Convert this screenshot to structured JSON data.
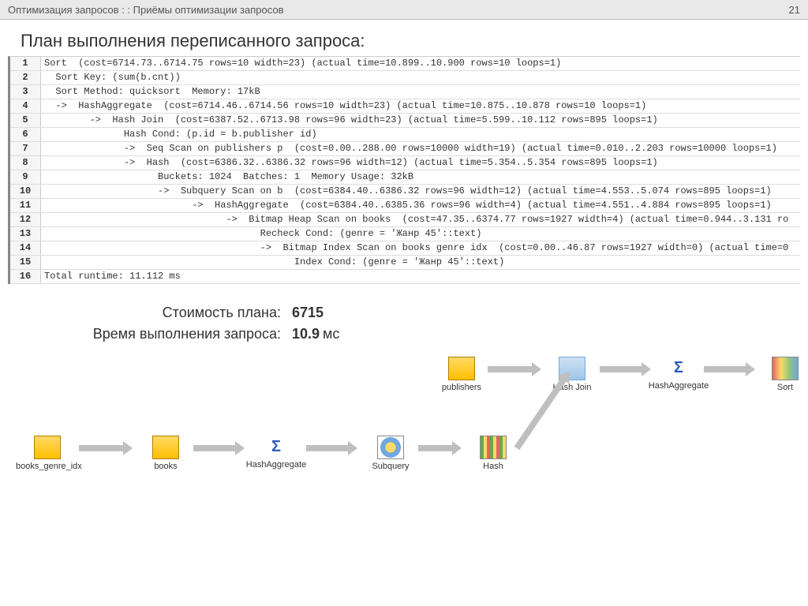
{
  "header": {
    "breadcrumb": "Оптимизация запросов  : :  Приёмы оптимизации запросов",
    "page": "21"
  },
  "title": "План выполнения переписанного запроса:",
  "plan_rows": [
    {
      "n": "1",
      "t": "Sort  (cost=6714.73..6714.75 rows=10 width=23) (actual time=10.899..10.900 rows=10 loops=1)"
    },
    {
      "n": "2",
      "t": "  Sort Key: (sum(b.cnt))"
    },
    {
      "n": "3",
      "t": "  Sort Method: quicksort  Memory: 17kB"
    },
    {
      "n": "4",
      "t": "  ->  HashAggregate  (cost=6714.46..6714.56 rows=10 width=23) (actual time=10.875..10.878 rows=10 loops=1)"
    },
    {
      "n": "5",
      "t": "        ->  Hash Join  (cost=6387.52..6713.98 rows=96 width=23) (actual time=5.599..10.112 rows=895 loops=1)"
    },
    {
      "n": "6",
      "t": "              Hash Cond: (p.id = b.publisher id)"
    },
    {
      "n": "7",
      "t": "              ->  Seq Scan on publishers p  (cost=0.00..288.00 rows=10000 width=19) (actual time=0.010..2.203 rows=10000 loops=1)"
    },
    {
      "n": "8",
      "t": "              ->  Hash  (cost=6386.32..6386.32 rows=96 width=12) (actual time=5.354..5.354 rows=895 loops=1)"
    },
    {
      "n": "9",
      "t": "                    Buckets: 1024  Batches: 1  Memory Usage: 32kB"
    },
    {
      "n": "10",
      "t": "                    ->  Subquery Scan on b  (cost=6384.40..6386.32 rows=96 width=12) (actual time=4.553..5.074 rows=895 loops=1)"
    },
    {
      "n": "11",
      "t": "                          ->  HashAggregate  (cost=6384.40..6385.36 rows=96 width=4) (actual time=4.551..4.884 rows=895 loops=1)"
    },
    {
      "n": "12",
      "t": "                                ->  Bitmap Heap Scan on books  (cost=47.35..6374.77 rows=1927 width=4) (actual time=0.944..3.131 ro"
    },
    {
      "n": "13",
      "t": "                                      Recheck Cond: (genre = 'Жанр 45'::text)"
    },
    {
      "n": "14",
      "t": "                                      ->  Bitmap Index Scan on books genre idx  (cost=0.00..46.87 rows=1927 width=0) (actual time=0"
    },
    {
      "n": "15",
      "t": "                                            Index Cond: (genre = 'Жанр 45'::text)"
    },
    {
      "n": "16",
      "t": "Total runtime: 11.112 ms"
    }
  ],
  "metrics": {
    "cost_label": "Стоимость плана:",
    "cost_value": "6715",
    "time_label": "Время выполнения запроса:",
    "time_value": "10.9",
    "time_unit": "мс"
  },
  "diagram": {
    "top_nodes": [
      {
        "id": "publishers",
        "label": "publishers",
        "icon": "tbl"
      },
      {
        "id": "hash-join",
        "label": "Hash Join",
        "icon": "join"
      },
      {
        "id": "hash-aggregate-top",
        "label": "HashAggregate",
        "icon": "sum"
      },
      {
        "id": "sort",
        "label": "Sort",
        "icon": "sort"
      }
    ],
    "bottom_nodes": [
      {
        "id": "books-genre-idx",
        "label": "books_genre_idx",
        "icon": "tbl"
      },
      {
        "id": "books",
        "label": "books",
        "icon": "tbl"
      },
      {
        "id": "hash-aggregate-bot",
        "label": "HashAggregate",
        "icon": "sum"
      },
      {
        "id": "subquery",
        "label": "Subquery",
        "icon": "subq"
      },
      {
        "id": "hash",
        "label": "Hash",
        "icon": "hash"
      }
    ]
  }
}
